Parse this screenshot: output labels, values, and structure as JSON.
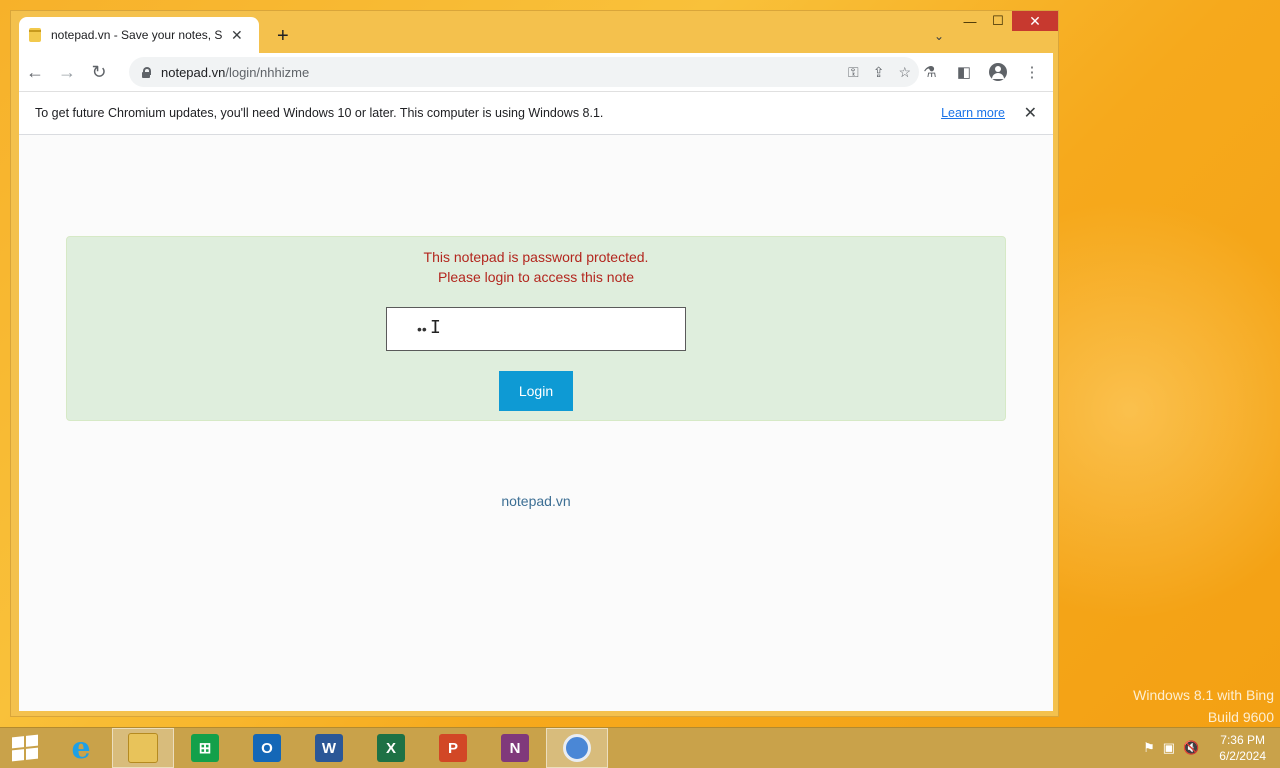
{
  "desktop": {
    "watermark_line1": "Windows 8.1 with Bing",
    "watermark_line2": "Build 9600"
  },
  "browser": {
    "tab": {
      "title": "notepad.vn - Save your notes, Sa"
    },
    "window_controls": {
      "minimize": "—",
      "maximize": "☐",
      "close": "✕"
    },
    "address": {
      "host": "notepad.vn",
      "path": "/login/nhhizme"
    },
    "infobar": {
      "text": "To get future Chromium updates, you'll need Windows 10 or later. This computer is using Windows 8.1.",
      "learn_more": "Learn more"
    }
  },
  "page": {
    "alert_line1": "This notepad is password protected.",
    "alert_line2": "Please login to access this note",
    "password_value": "••",
    "login_label": "Login",
    "footer_link": "notepad.vn"
  },
  "taskbar": {
    "apps": [
      "internet-explorer",
      "file-explorer",
      "store",
      "outlook",
      "word",
      "excel",
      "powerpoint",
      "onenote",
      "chrome"
    ],
    "clock_time": "7:36 PM",
    "clock_date": "6/2/2024"
  },
  "colors": {
    "alert_bg": "#dfeedd",
    "alert_text": "#b3261e",
    "login_button": "#0e9ad4",
    "desktop_bg": "#f7b12a"
  }
}
